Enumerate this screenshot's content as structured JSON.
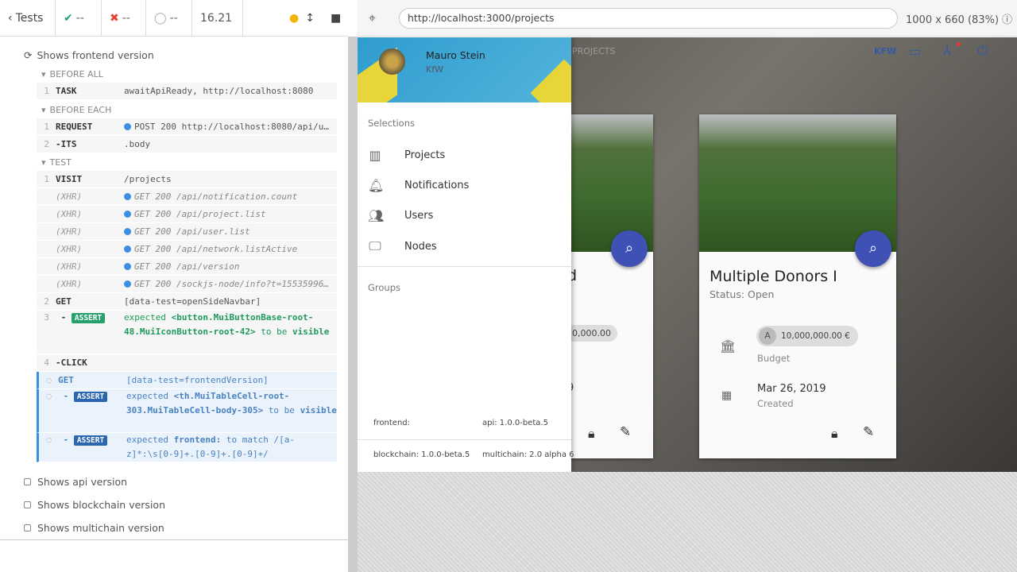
{
  "header": {
    "tests_label": "Tests",
    "passed": "--",
    "failed": "--",
    "pending": "--",
    "duration": "16.21"
  },
  "aut": {
    "url": "http://localhost:3000/projects",
    "viewport": "1000 x 660 (83%)"
  },
  "reporter": {
    "test_title": "Shows frontend version",
    "before_all": "BEFORE ALL",
    "before_each": "BEFORE EACH",
    "test_hook": "TEST",
    "commands_before_all": [
      {
        "n": "1",
        "name": "TASK",
        "msg": "awaitApiReady, http://localhost:8080"
      }
    ],
    "commands_before_each": [
      {
        "n": "1",
        "name": "REQUEST",
        "msg": "POST 200 http://localhost:8080/api/u…"
      },
      {
        "n": "2",
        "name": "-ITS",
        "msg": ".body"
      }
    ],
    "test_commands": [
      {
        "n": "1",
        "name": "VISIT",
        "msg": "/projects"
      },
      {
        "n": "",
        "name": "(XHR)",
        "msg": "GET 200 /api/notification.count"
      },
      {
        "n": "",
        "name": "(XHR)",
        "msg": "GET 200 /api/project.list"
      },
      {
        "n": "",
        "name": "(XHR)",
        "msg": "GET 200 /api/user.list"
      },
      {
        "n": "",
        "name": "(XHR)",
        "msg": "GET 200 /api/network.listActive"
      },
      {
        "n": "",
        "name": "(XHR)",
        "msg": "GET 200 /api/version"
      },
      {
        "n": "",
        "name": "(XHR)",
        "msg": "GET 200 /sockjs-node/info?t=15535996…"
      },
      {
        "n": "2",
        "name": "GET",
        "msg": "[data-test=openSideNavbar]"
      }
    ],
    "assert1": {
      "n": "3",
      "badge": "ASSERT",
      "expected": "expected",
      "sel": "<button.MuiButtonBase-root-48.MuiIconButton-root-42>",
      "tail": "to be",
      "tail2": "visible"
    },
    "click": {
      "n": "4",
      "name": "-CLICK"
    },
    "running_get": {
      "name": "GET",
      "msg": "[data-test=frontendVersion]"
    },
    "assert2": {
      "badge": "ASSERT",
      "expected": "expected",
      "sel": "<th.MuiTableCell-root-303.MuiTableCell-body-305>",
      "tail": "to be",
      "tail2": "visible"
    },
    "assert3": {
      "badge": "ASSERT",
      "expected": "expected",
      "sel": "frontend:",
      "tail": "to match /[a-",
      "tail2": "z]*:\\s[0-9]+.[0-9]+.[0-9]+/"
    },
    "pending_tests": [
      "Shows api version",
      "Shows blockchain version",
      "Shows multichain version"
    ]
  },
  "app": {
    "user_name": "Mauro Stein",
    "user_org": "KfW",
    "tab_projects": "PROJECTS",
    "org_short": "KFW",
    "selections_label": "Selections",
    "menu": [
      "Projects",
      "Notifications",
      "Users",
      "Nodes"
    ],
    "groups_label": "Groups",
    "versions": {
      "frontend": "frontend:",
      "api": "api: 1.0.0-beta.5",
      "blockchain": "blockchain: 1.0.0-beta.5",
      "multichain": "multichain: 2.0 alpha 6"
    },
    "card1": {
      "title_tail": "d",
      "budget": "0,000.00",
      "date_tail": "9"
    },
    "card2": {
      "title": "Multiple Donors I",
      "status": "Status: Open",
      "budget": "10,000,000.00 €",
      "budget_label": "Budget",
      "avatar": "A",
      "date": "Mar 26, 2019",
      "date_label": "Created"
    }
  }
}
